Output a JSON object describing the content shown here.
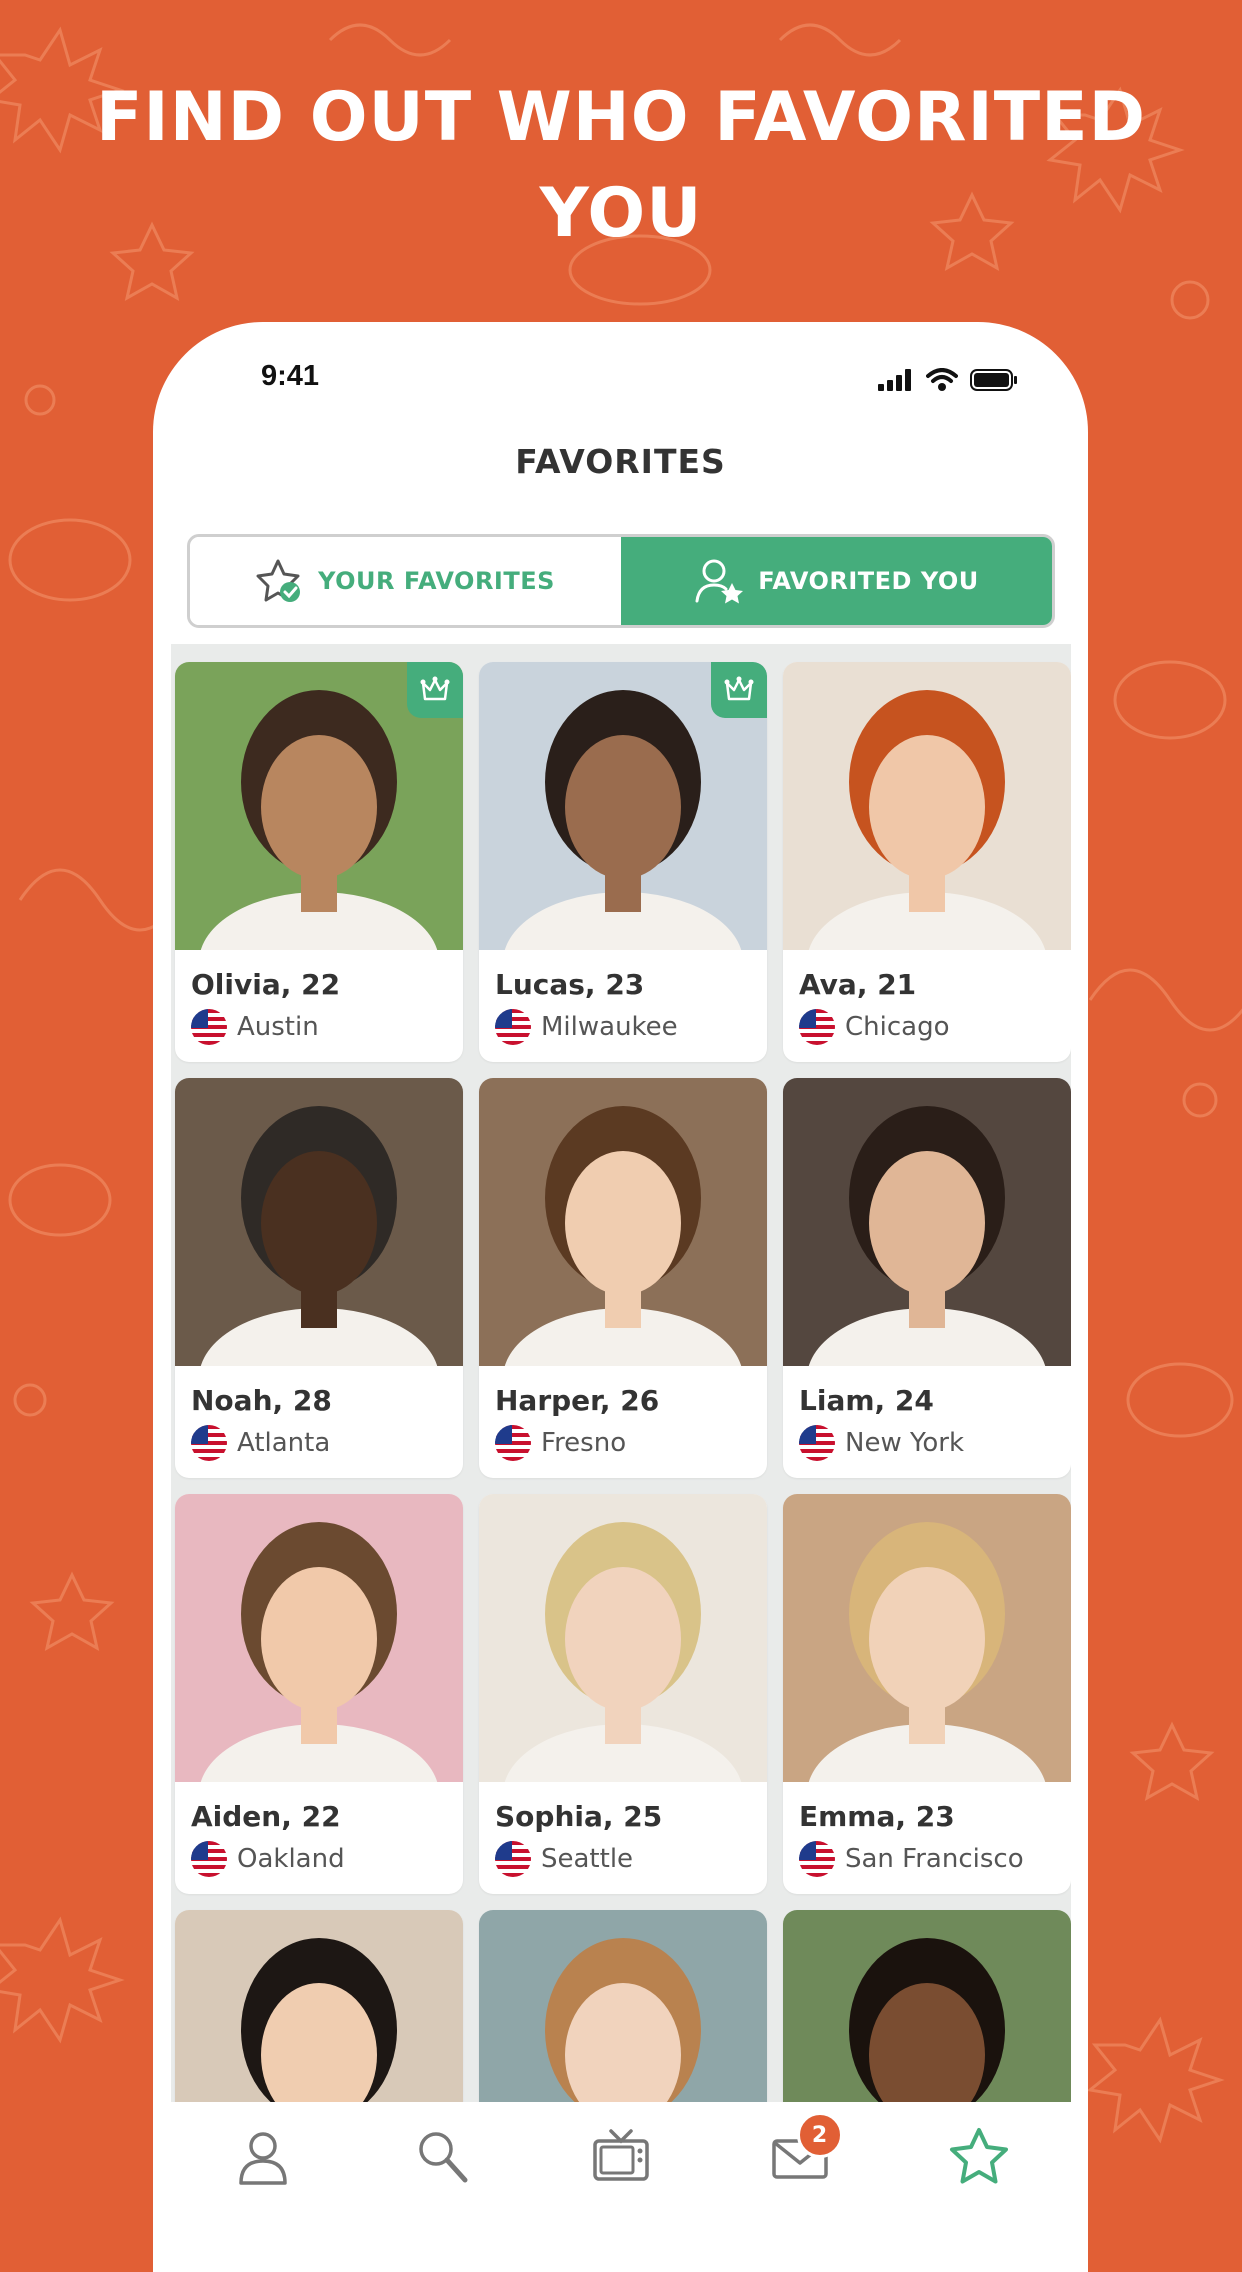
{
  "promo": {
    "headline_line1": "FIND OUT WHO FAVORITED",
    "headline_line2": "YOU"
  },
  "status_bar": {
    "time": "9:41",
    "icons": [
      "signal-icon",
      "wifi-icon",
      "battery-icon"
    ]
  },
  "screen": {
    "title": "FAVORITES"
  },
  "tabs": [
    {
      "label": "YOUR FAVORITES",
      "icon": "star-check-icon",
      "selected": false
    },
    {
      "label": "FAVORITED YOU",
      "icon": "user-star-icon",
      "selected": true
    }
  ],
  "profiles": [
    {
      "name_age": "Olivia, 22",
      "city": "Austin",
      "premium": true
    },
    {
      "name_age": "Lucas, 23",
      "city": "Milwaukee",
      "premium": true
    },
    {
      "name_age": "Ava, 21",
      "city": "Chicago",
      "premium": false
    },
    {
      "name_age": "Noah, 28",
      "city": "Atlanta",
      "premium": false
    },
    {
      "name_age": "Harper, 26",
      "city": "Fresno",
      "premium": false
    },
    {
      "name_age": "Liam, 24",
      "city": "New York",
      "premium": false
    },
    {
      "name_age": "Aiden, 22",
      "city": "Oakland",
      "premium": false
    },
    {
      "name_age": "Sophia, 25",
      "city": "Seattle",
      "premium": false
    },
    {
      "name_age": "Emma, 23",
      "city": "San Francisco",
      "premium": false
    },
    {
      "name_age": "",
      "city": "",
      "premium": false
    },
    {
      "name_age": "",
      "city": "",
      "premium": false
    },
    {
      "name_age": "",
      "city": "",
      "premium": false
    }
  ],
  "bottom_nav": {
    "items": [
      "profile-icon",
      "search-icon",
      "tv-icon",
      "messages-icon",
      "favorites-star-icon"
    ],
    "messages_badge": "2",
    "active": "favorites-star-icon"
  },
  "colors": {
    "background": "#e15f35",
    "accent_green": "#45ad7c",
    "badge": "#e15f35"
  }
}
